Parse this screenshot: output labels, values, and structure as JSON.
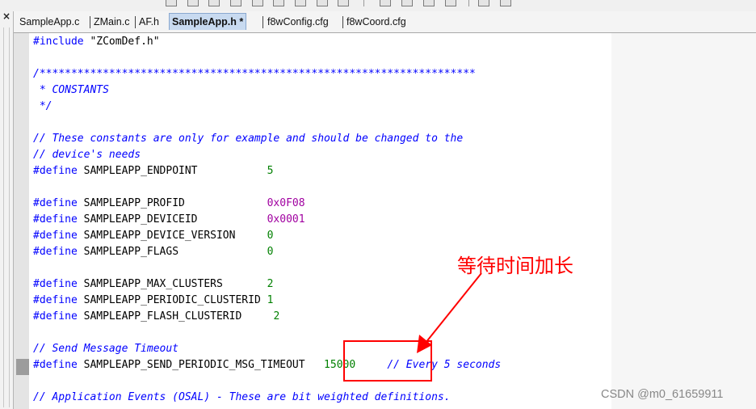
{
  "tabs": [
    {
      "label": "SampleApp.c",
      "active": false
    },
    {
      "label": "ZMain.c",
      "active": false
    },
    {
      "label": "AF.h",
      "active": false
    },
    {
      "label": "SampleApp.h *",
      "active": true
    },
    {
      "label": "f8wConfig.cfg",
      "active": false
    },
    {
      "label": "f8wCoord.cfg",
      "active": false
    }
  ],
  "left_panel": {
    "close_glyph": "×"
  },
  "code": {
    "l1": {
      "kw": "#include",
      "rest": " \"ZComDef.h\""
    },
    "l3": {
      "cm": "/*********************************************************************"
    },
    "l4": {
      "cm": " * CONSTANTS"
    },
    "l5": {
      "cm": " */"
    },
    "l7": {
      "cm": "// These constants are only for example and should be changed to the"
    },
    "l8": {
      "cm": "// device's needs"
    },
    "l9": {
      "kw": "#define",
      "name": " SAMPLEAPP_ENDPOINT           ",
      "value": "5"
    },
    "l11": {
      "kw": "#define",
      "name": " SAMPLEAPP_PROFID             ",
      "value": "0x0F08"
    },
    "l12": {
      "kw": "#define",
      "name": " SAMPLEAPP_DEVICEID           ",
      "value": "0x0001"
    },
    "l13": {
      "kw": "#define",
      "name": " SAMPLEAPP_DEVICE_VERSION     ",
      "value": "0"
    },
    "l14": {
      "kw": "#define",
      "name": " SAMPLEAPP_FLAGS              ",
      "value": "0"
    },
    "l16": {
      "kw": "#define",
      "name": " SAMPLEAPP_MAX_CLUSTERS       ",
      "value": "2"
    },
    "l17": {
      "kw": "#define",
      "name": " SAMPLEAPP_PERIODIC_CLUSTERID ",
      "value": "1"
    },
    "l18": {
      "kw": "#define",
      "name": " SAMPLEAPP_FLASH_CLUSTERID     ",
      "value": "2"
    },
    "l20": {
      "cm": "// Send Message Timeout"
    },
    "l21": {
      "kw": "#define",
      "name": " SAMPLEAPP_SEND_PERIODIC_MSG_TIMEOUT   ",
      "value": "15000",
      "gap": "     ",
      "cm": "// Every 5 seconds"
    },
    "l23": {
      "cm": "// Application Events (OSAL) - These are bit weighted definitions."
    }
  },
  "annotation": {
    "text": "等待时间加长",
    "color": "#ff0000"
  },
  "watermark": "CSDN @m0_61659911"
}
